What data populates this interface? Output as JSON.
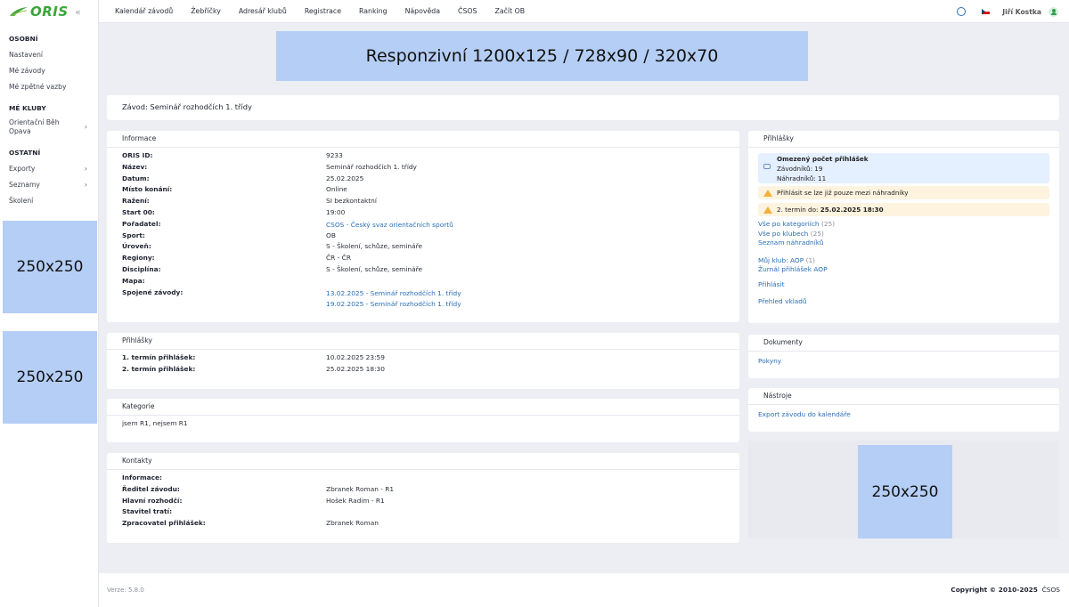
{
  "app": {
    "logo_text": "ORIS",
    "collapse_icon": "chevron-double-left-icon"
  },
  "nav": {
    "items": [
      "Kalendář závodů",
      "Žebříčky",
      "Adresář klubů",
      "Registrace",
      "Ranking",
      "Nápověda",
      "ČSOS",
      "Začít OB"
    ],
    "user_name": "Jiří Kostka",
    "language": "cs"
  },
  "sidebar": {
    "sections": [
      {
        "title": "OSOBNÍ",
        "items": [
          "Nastavení",
          "Mé závody",
          "Mé zpětné vazby"
        ]
      },
      {
        "title": "MÉ KLUBY",
        "items": [
          "Orientační Běh Opava"
        ]
      },
      {
        "title": "OSTATNÍ",
        "items": [
          "Exporty",
          "Seznamy",
          "Školení"
        ]
      }
    ],
    "ads": [
      "250x250",
      "250x250"
    ]
  },
  "banner": {
    "text": "Responzivní 1200x125 / 728x90 / 320x70"
  },
  "event": {
    "title": "Závod: Seminář rozhodčích 1. třídy"
  },
  "info": {
    "header": "Informace",
    "rows": [
      {
        "label": "ORIS ID:",
        "value": "9233"
      },
      {
        "label": "Název:",
        "value": "Seminář rozhodčích 1. třídy"
      },
      {
        "label": "Datum:",
        "value": "25.02.2025"
      },
      {
        "label": "Místo konání:",
        "value": "Online"
      },
      {
        "label": "Ražení:",
        "value": "SI bezkontaktní"
      },
      {
        "label": "Start 00:",
        "value": "19:00"
      },
      {
        "label": "Pořadatel:",
        "value": "CSOS - Český svaz orientačních sportů"
      },
      {
        "label": "Sport:",
        "value": "OB"
      },
      {
        "label": "Úroveň:",
        "value": "S - Školení, schůze, semináře"
      },
      {
        "label": "Regiony:",
        "value": "ČR - ČR"
      },
      {
        "label": "Disciplína:",
        "value": "S - Školení, schůze, semináře"
      },
      {
        "label": "Mapa:",
        "value": ""
      },
      {
        "label": "Spojené závody:",
        "links": [
          "13.02.2025 - Seminář rozhodčích 1. třídy",
          "19.02.2025 - Seminář rozhodčích 1. třídy"
        ]
      }
    ]
  },
  "registration": {
    "header": "Přihlášky",
    "rows": [
      {
        "label": "1. termín přihlášek:",
        "value": "10.02.2025 23:59"
      },
      {
        "label": "2. termín přihlášek:",
        "value": "25.02.2025 18:30"
      }
    ]
  },
  "categories": {
    "header": "Kategorie",
    "text": "jsem R1, nejsem R1"
  },
  "contacts": {
    "header": "Kontakty",
    "rows": [
      {
        "label": "Informace:",
        "value": ""
      },
      {
        "label": "Ředitel závodu:",
        "value": "Zbranek Roman - R1"
      },
      {
        "label": "Hlavní rozhodčí:",
        "value": "Hošek Radim - R1"
      },
      {
        "label": "Stavitel tratí:",
        "value": ""
      },
      {
        "label": "Zpracovatel přihlášek:",
        "value": "Zbranek Roman"
      }
    ]
  },
  "entries_panel": {
    "header": "Přihlášky",
    "limit_title": "Omezený počet přihlášek",
    "racers": "Závodníků: 19",
    "substitutes": "Náhradníků: 11",
    "warn_text": "Přihlásit se lze již pouze mezi náhradníky",
    "deadline_prefix": "2. termín do:",
    "deadline_value": "25.02.2025 18:30",
    "links_a": [
      {
        "label": "Vše po kategoriích",
        "count": "(25)"
      },
      {
        "label": "Vše po klubech",
        "count": "(25)"
      },
      {
        "label": "Seznam náhradníků",
        "count": ""
      }
    ],
    "links_b": [
      {
        "label": "Můj klub: AOP",
        "count": "(1)"
      },
      {
        "label": "Žurnál přihlášek AOP",
        "count": ""
      }
    ],
    "signup": "Přihlásit",
    "fees": "Přehled vkladů"
  },
  "documents": {
    "header": "Dokumenty",
    "link": "Pokyny"
  },
  "tools": {
    "header": "Nástroje",
    "link": "Export závodu do kalendáře"
  },
  "right_ad": "250x250",
  "footer": {
    "version": "Verze: 5.8.0",
    "copyright": "Copyright © 2010-2025",
    "org": "ČSOS"
  },
  "colors": {
    "accent": "#2a6eb5",
    "logo": "#3aa53a",
    "ad": "#b5cef5",
    "info_bg": "#e4efff",
    "warn_bg": "#fdf3df"
  }
}
